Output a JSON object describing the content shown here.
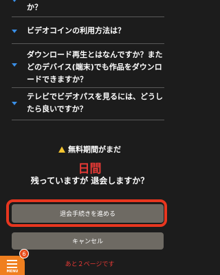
{
  "faq": {
    "items": [
      {
        "question": "か？"
      },
      {
        "question": "ビデオコインの利用方法は？"
      },
      {
        "question": "ダウンロード再生とはなんですか？またどのデバイス(端末)でも作品をダウンロードできますか？"
      },
      {
        "question": "テレビでビデオパスを見るには、どうしたら良いですか？"
      }
    ]
  },
  "notice": {
    "warning_text": "無料期間がまだ",
    "remaining_days": "日間",
    "question": "残っていますが 退会しますか？"
  },
  "buttons": {
    "proceed_label": "退会手続きを進める",
    "cancel_label": "キャンセル"
  },
  "menu": {
    "label": "MENU",
    "badge_count": "6"
  },
  "footer": {
    "pages_left": "あと２ページです"
  },
  "colors": {
    "background": "#1c1c1c",
    "accent_blue": "#3a8fe6",
    "alert_red": "#e53935",
    "highlight_border": "#e8361f",
    "button_gray": "#6e6a63",
    "menu_orange": "#f07f1f"
  },
  "icons": {
    "faq_expand": "chevron-down-icon",
    "warning": "warning-icon",
    "menu": "hamburger-icon"
  }
}
